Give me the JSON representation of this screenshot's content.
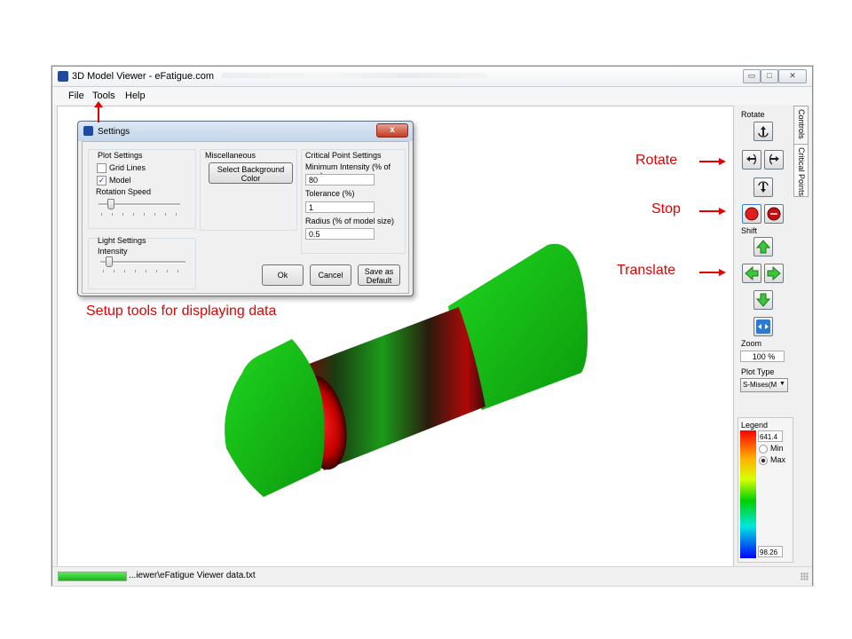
{
  "window": {
    "title": "3D Model Viewer - eFatigue.com",
    "minimize_label": "▭",
    "maximize_label": "□",
    "close_label": "✕"
  },
  "menu": {
    "items": [
      "File",
      "Tools",
      "Help"
    ]
  },
  "status": {
    "progress": 1.0,
    "text": "...iewer\\eFatigue Viewer data.txt"
  },
  "controls": {
    "tabs": [
      "Controls",
      "Critical Points"
    ],
    "rotate_label": "Rotate",
    "shift_label": "Shift",
    "zoom_label": "Zoom",
    "zoom_value": "100  %",
    "plot_type_label": "Plot Type",
    "plot_type_value": "S-Mises(M",
    "legend": {
      "title": "Legend",
      "max_value": "641.4",
      "min_value": "98.26",
      "radio_min": "Min",
      "radio_max": "Max",
      "selected": "Max"
    }
  },
  "dialog": {
    "title": "Settings",
    "close_label": "x",
    "plot_settings": {
      "title": "Plot Settings",
      "grid_lines_label": "Grid Lines",
      "grid_lines_checked": false,
      "model_label": "Model",
      "model_checked": true,
      "rotation_speed_label": "Rotation Speed",
      "rotation_speed_level": 0.15
    },
    "light_settings": {
      "title": "Light Settings",
      "intensity_label": "Intensity",
      "intensity_level": 0.1
    },
    "misc": {
      "title": "Miscellaneous",
      "bg_button_label": "Select Background Color"
    },
    "critical": {
      "title": "Critical Point Settings",
      "min_intensity_label": "Minimum Intensity (% of max)",
      "min_intensity_value": "80",
      "tolerance_label": "Tolerance (%)",
      "tolerance_value": "1",
      "radius_label": "Radius (% of model size)",
      "radius_value": "0.5"
    },
    "ok_label": "Ok",
    "cancel_label": "Cancel",
    "save_default_label": "Save as Default"
  },
  "annotations": {
    "rotate": "Rotate",
    "stop": "Stop",
    "translate": "Translate",
    "setup": "Setup tools for displaying data"
  },
  "colors": {
    "annotation": "#e20000",
    "model_green": "#22dd22",
    "model_red": "#e01010",
    "shift_button": "#3cc63c",
    "stop_button": "#e02020"
  }
}
